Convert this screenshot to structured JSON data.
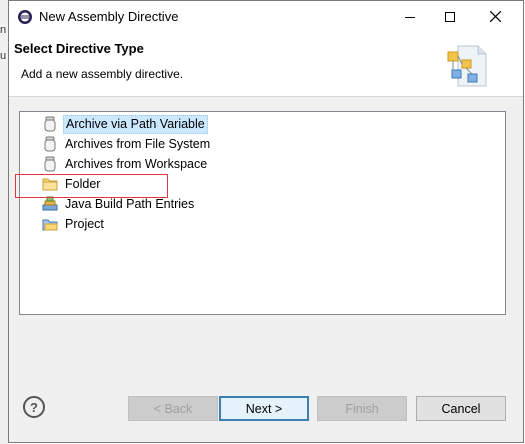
{
  "window": {
    "title": "New Assembly Directive"
  },
  "header": {
    "title": "Select Directive Type",
    "description": "Add a new assembly directive."
  },
  "tree": {
    "items": [
      {
        "label": "Archive via Path Variable",
        "icon": "archive-jar-icon",
        "selected": true
      },
      {
        "label": "Archives from File System",
        "icon": "archive-jar-icon",
        "selected": false
      },
      {
        "label": "Archives from Workspace",
        "icon": "archive-jar-icon",
        "selected": false
      },
      {
        "label": "Folder",
        "icon": "folder-icon",
        "selected": false,
        "highlighted": true
      },
      {
        "label": "Java Build Path Entries",
        "icon": "library-icon",
        "selected": false
      },
      {
        "label": "Project",
        "icon": "project-folder-icon",
        "selected": false
      }
    ]
  },
  "buttons": {
    "help": "?",
    "back": "< Back",
    "next": "Next >",
    "finish": "Finish",
    "cancel": "Cancel"
  },
  "colors": {
    "selection": "#cce8ff",
    "highlight_box": "#e0383e",
    "default_button_border": "#3c7fb1"
  }
}
